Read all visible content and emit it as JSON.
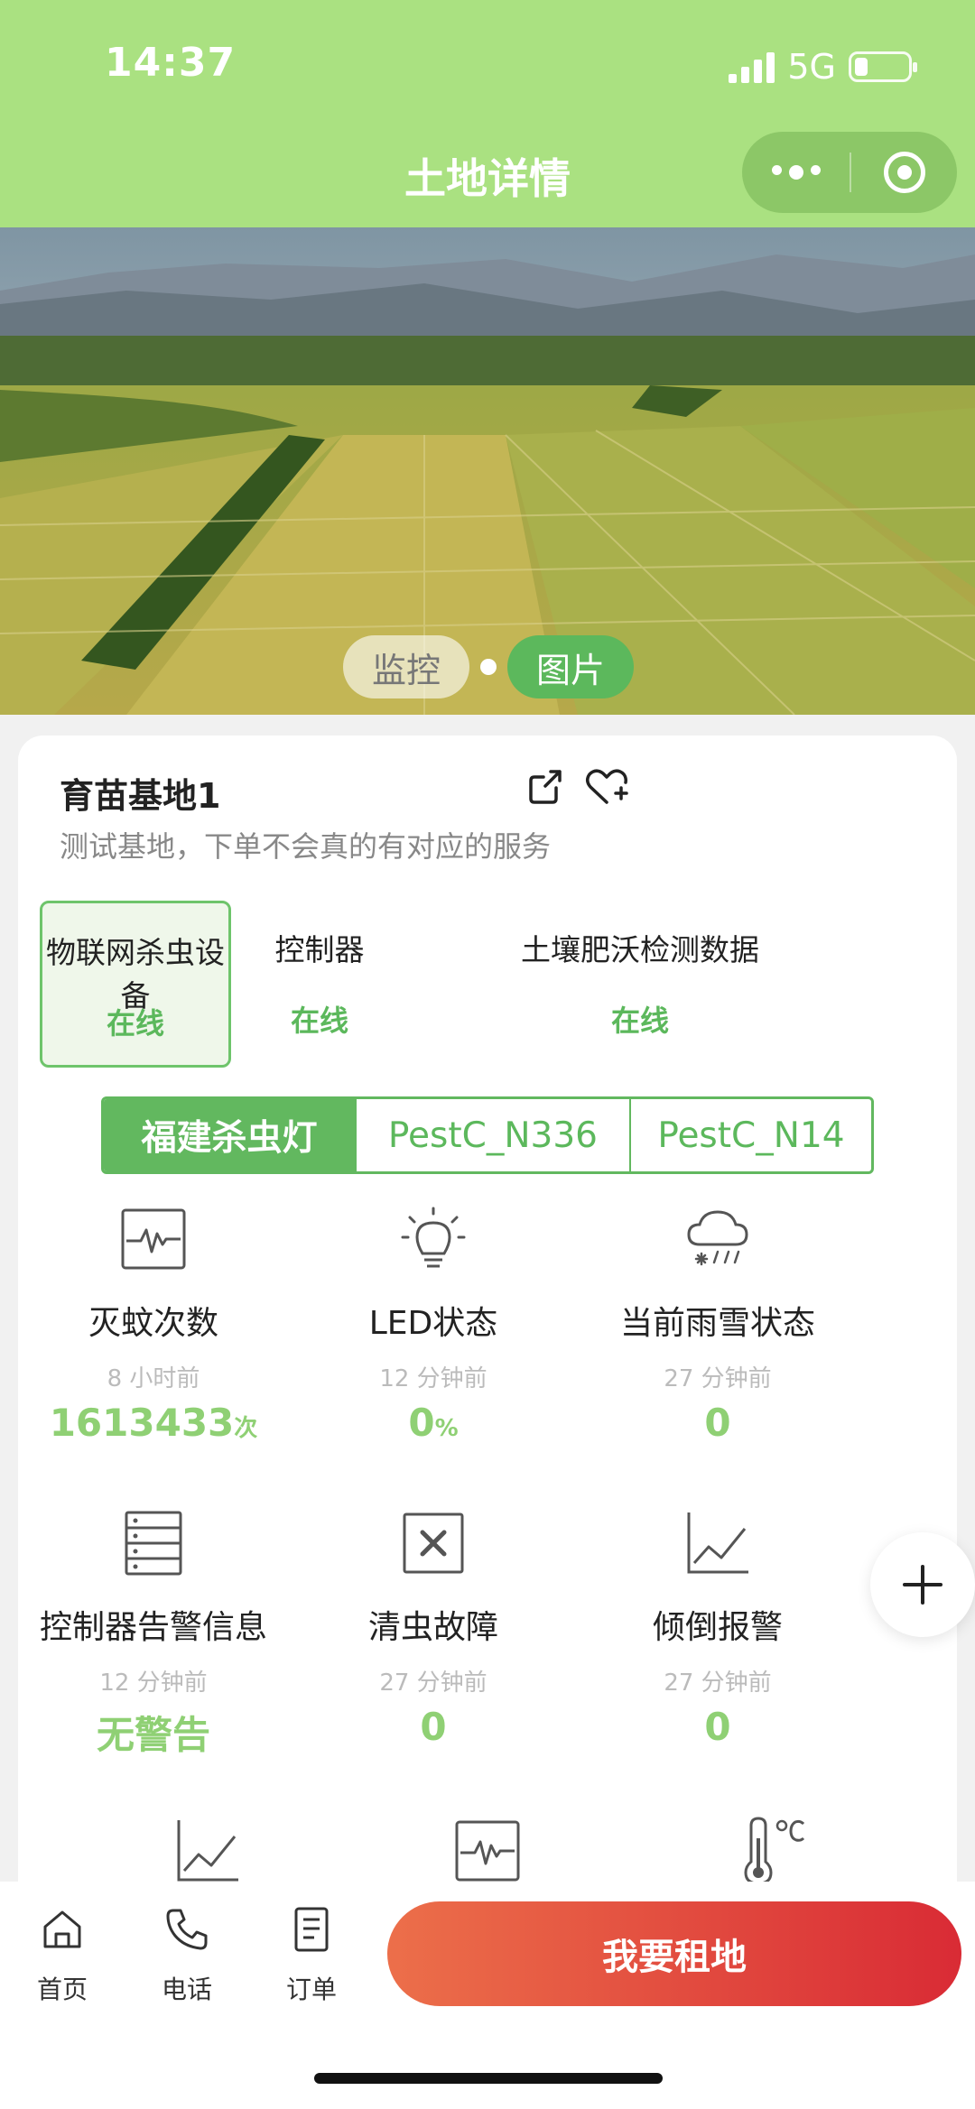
{
  "status_bar": {
    "time": "14:37",
    "network": "5G"
  },
  "header": {
    "title": "土地详情"
  },
  "hero": {
    "tabs": [
      "监控",
      "图片"
    ],
    "active_tab": 1
  },
  "farm": {
    "name": "育苗基地1",
    "description": "测试基地，下单不会真的有对应的服务"
  },
  "devices": [
    {
      "label": "物联网杀虫设备",
      "status": "在线"
    },
    {
      "label": "控制器",
      "status": "在线"
    },
    {
      "label": "土壤肥沃检测数据",
      "status": "在线"
    }
  ],
  "sub_tabs": [
    "福建杀虫灯",
    "PestC_N336",
    "PestC_N14"
  ],
  "metrics": [
    {
      "label": "灭蚊次数",
      "time": "8 小时前",
      "value": "1613433",
      "unit": "次",
      "icon": "waveform-icon"
    },
    {
      "label": "LED状态",
      "time": "12 分钟前",
      "value": "0",
      "unit": "%",
      "icon": "lightbulb-icon"
    },
    {
      "label": "当前雨雪状态",
      "time": "27 分钟前",
      "value": "0",
      "unit": "",
      "icon": "snow-cloud-icon"
    },
    {
      "label": "控制器告警信息",
      "time": "12 分钟前",
      "value": "无警告",
      "unit": "",
      "icon": "server-list-icon"
    },
    {
      "label": "清虫故障",
      "time": "27 分钟前",
      "value": "0",
      "unit": "",
      "icon": "x-box-icon"
    },
    {
      "label": "倾倒报警",
      "time": "27 分钟前",
      "value": "0",
      "unit": "",
      "icon": "line-chart-icon"
    }
  ],
  "partial_icons": [
    "line-chart-icon",
    "waveform-icon",
    "thermometer-icon"
  ],
  "bottom_nav": [
    {
      "label": "首页",
      "icon": "home-icon"
    },
    {
      "label": "电话",
      "icon": "phone-icon"
    },
    {
      "label": "订单",
      "icon": "order-icon"
    }
  ],
  "cta": {
    "label": "我要租地"
  },
  "colors": {
    "header_bg": "#aae181",
    "accent_green": "#5cb85c",
    "value_green": "#8fd074",
    "cta_start": "#ec6f4a",
    "cta_end": "#d92b35"
  }
}
